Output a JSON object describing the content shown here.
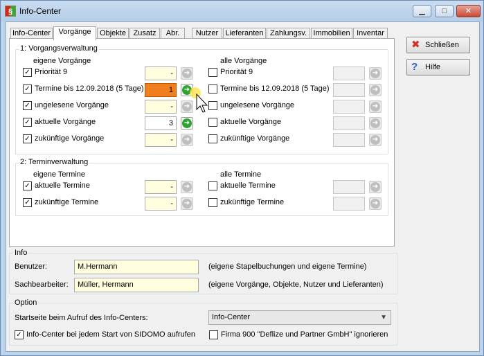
{
  "window": {
    "title": "Info-Center",
    "minimize": "▁",
    "maximize": "□",
    "close": "✕"
  },
  "tabs": [
    {
      "label": "Info-Center"
    },
    {
      "label": "Vorgänge",
      "active": true
    },
    {
      "label": "Objekte"
    },
    {
      "label": "Zusatz"
    },
    {
      "label": "Abr."
    },
    {
      "label": "Nutzer"
    },
    {
      "label": "Lieferanten"
    },
    {
      "label": "Zahlungsv."
    },
    {
      "label": "Immobilien"
    },
    {
      "label": "Inventar"
    }
  ],
  "vorgang": {
    "group_title": "1: Vorgangsverwaltung",
    "own_header": "eigene Vorgänge",
    "all_header": "alle Vorgänge",
    "own": [
      {
        "label": "Priorität 9",
        "checked": true,
        "value": "-"
      },
      {
        "label": "Termine bis 12.09.2018 (5 Tage)",
        "checked": true,
        "value": "1"
      },
      {
        "label": "ungelesene Vorgänge",
        "checked": true,
        "value": "-"
      },
      {
        "label": "aktuelle Vorgänge",
        "checked": true,
        "value": "3"
      },
      {
        "label": "zukünftige Vorgänge",
        "checked": true,
        "value": "-"
      }
    ],
    "all": [
      {
        "label": "Priorität 9",
        "checked": false,
        "value": ""
      },
      {
        "label": "Termine bis 12.09.2018 (5 Tage)",
        "checked": false,
        "value": ""
      },
      {
        "label": "ungelesene Vorgänge",
        "checked": false,
        "value": ""
      },
      {
        "label": "aktuelle Vorgänge",
        "checked": false,
        "value": ""
      },
      {
        "label": "zukünftige Vorgänge",
        "checked": false,
        "value": ""
      }
    ]
  },
  "termin": {
    "group_title": "2: Terminverwaltung",
    "own_header": "eigene Termine",
    "all_header": "alle Termine",
    "own": [
      {
        "label": "aktuelle Termine",
        "checked": true,
        "value": "-"
      },
      {
        "label": "zukünftige Termine",
        "checked": true,
        "value": "-"
      }
    ],
    "all": [
      {
        "label": "aktuelle Termine",
        "checked": false,
        "value": ""
      },
      {
        "label": "zukünftige Termine",
        "checked": false,
        "value": ""
      }
    ]
  },
  "buttons": {
    "close_label": "Schließen",
    "help_label": "Hilfe",
    "close_icon": "✖",
    "help_icon": "?"
  },
  "info": {
    "title": "Info",
    "user_label": "Benutzer:",
    "user_value": "M.Hermann",
    "user_note": "(eigene Stapelbuchungen und eigene Termine)",
    "clerk_label": "Sachbearbeiter:",
    "clerk_value": "Müller, Hermann",
    "clerk_note": "(eigene Vorgänge, Objekte, Nutzer und Lieferanten)"
  },
  "option": {
    "title": "Option",
    "start_label": "Startseite beim Aufruf des Info-Centers:",
    "start_value": "Info-Center",
    "open_label": "Info-Center bei jedem Start von SIDOMO aufrufen",
    "open_checked": true,
    "ignore_label": "Firma 900 \"Deflize und Partner GmbH\" ignorieren",
    "ignore_checked": false
  },
  "colors": {
    "accent_field": "#f07e1f",
    "highlight_field": "#ffffe0",
    "go_green": "#2ea42e"
  }
}
